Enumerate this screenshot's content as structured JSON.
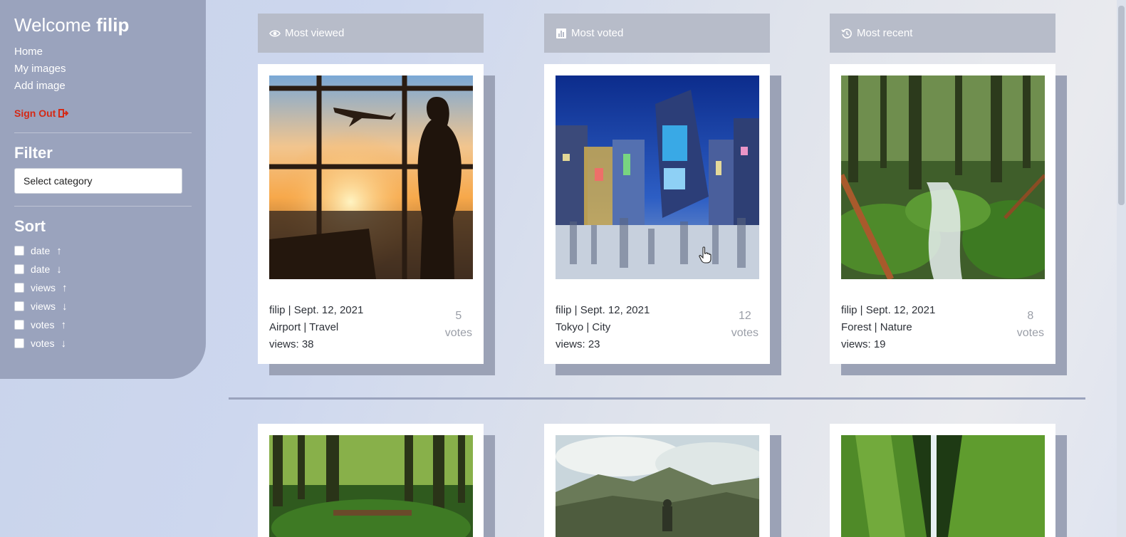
{
  "sidebar": {
    "welcome_prefix": "Welcome ",
    "username": "filip",
    "nav": [
      "Home",
      "My images",
      "Add image"
    ],
    "sign_out": "Sign Out",
    "filter_heading": "Filter",
    "filter_select": "Select category",
    "sort_heading": "Sort",
    "sort_options": [
      {
        "label": "date",
        "arrow": "↑"
      },
      {
        "label": "date",
        "arrow": "↓"
      },
      {
        "label": "views",
        "arrow": "↑"
      },
      {
        "label": "views",
        "arrow": "↓"
      },
      {
        "label": "votes",
        "arrow": "↑"
      },
      {
        "label": "votes",
        "arrow": "↓"
      }
    ]
  },
  "columns": {
    "most_viewed": "Most viewed",
    "most_voted": "Most voted",
    "most_recent": "Most recent"
  },
  "cards": [
    {
      "user_date": "filip | Sept. 12, 2021",
      "tags": "Airport | Travel",
      "views": "views: 38",
      "vote_count": "5",
      "vote_label": "votes"
    },
    {
      "user_date": "filip | Sept. 12, 2021",
      "tags": "Tokyo | City",
      "views": "views: 23",
      "vote_count": "12",
      "vote_label": "votes"
    },
    {
      "user_date": "filip | Sept. 12, 2021",
      "tags": "Forest | Nature",
      "views": "views: 19",
      "vote_count": "8",
      "vote_label": "votes"
    }
  ],
  "colors": {
    "sidebar": "#9aa3bd",
    "sign_out": "#d42a16",
    "column_header": "#b7bcc9"
  }
}
